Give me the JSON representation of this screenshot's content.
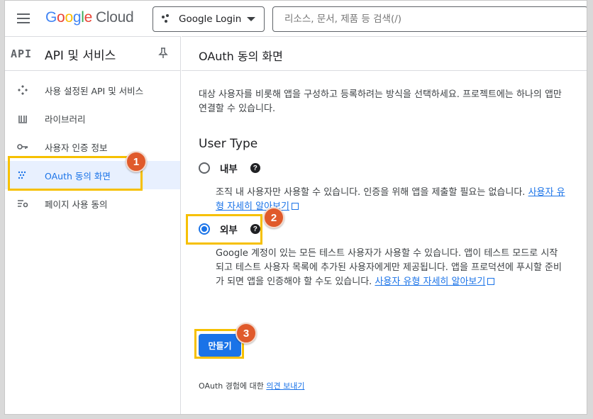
{
  "topbar": {
    "logo_google": [
      "G",
      "o",
      "o",
      "g",
      "l",
      "e"
    ],
    "logo_cloud": "Cloud",
    "project_name": "Google Login",
    "search_placeholder": "리소스, 문서, 제품 등 검색(/)"
  },
  "sidebar": {
    "badge": "API",
    "title": "API 및 서비스",
    "items": [
      {
        "label": "사용 설정된 API 및 서비스",
        "icon": "api-diamond-icon"
      },
      {
        "label": "라이브러리",
        "icon": "library-icon"
      },
      {
        "label": "사용자 인증 정보",
        "icon": "key-icon"
      },
      {
        "label": "OAuth 동의 화면",
        "icon": "oauth-consent-icon",
        "active": true
      },
      {
        "label": "페이지 사용 동의",
        "icon": "page-settings-icon"
      }
    ]
  },
  "main": {
    "title": "OAuth 동의 화면",
    "description": "대상 사용자를 비롯해 앱을 구성하고 등록하려는 방식을 선택하세요. 프로젝트에는 하나의 앱만 연결할 수 있습니다.",
    "user_type_heading": "User Type",
    "internal": {
      "label": "내부",
      "desc": "조직 내 사용자만 사용할 수 있습니다. 인증을 위해 앱을 제출할 필요는 없습니다.",
      "link": "사용자 유형 자세히 알아보기",
      "selected": false
    },
    "external": {
      "label": "외부",
      "desc": "Google 계정이 있는 모든 테스트 사용자가 사용할 수 있습니다. 앱이 테스트 모드로 시작되고 테스트 사용자 목록에 추가된 사용자에게만 제공됩니다. 앱을 프로덕션에 푸시할 준비가 되면 앱을 인증해야 할 수도 있습니다.",
      "link": "사용자 유형 자세히 알아보기",
      "selected": true
    },
    "create_button": "만들기",
    "feedback_prefix": "OAuth 경험에 대한",
    "feedback_link": "의견 보내기"
  },
  "annotations": {
    "step1": "1",
    "step2": "2",
    "step3": "3",
    "highlight_color": "#f6c000",
    "badge_color": "#e05a2b"
  },
  "colors": {
    "accent": "#1a73e8",
    "active_bg": "#e8f0fe"
  }
}
